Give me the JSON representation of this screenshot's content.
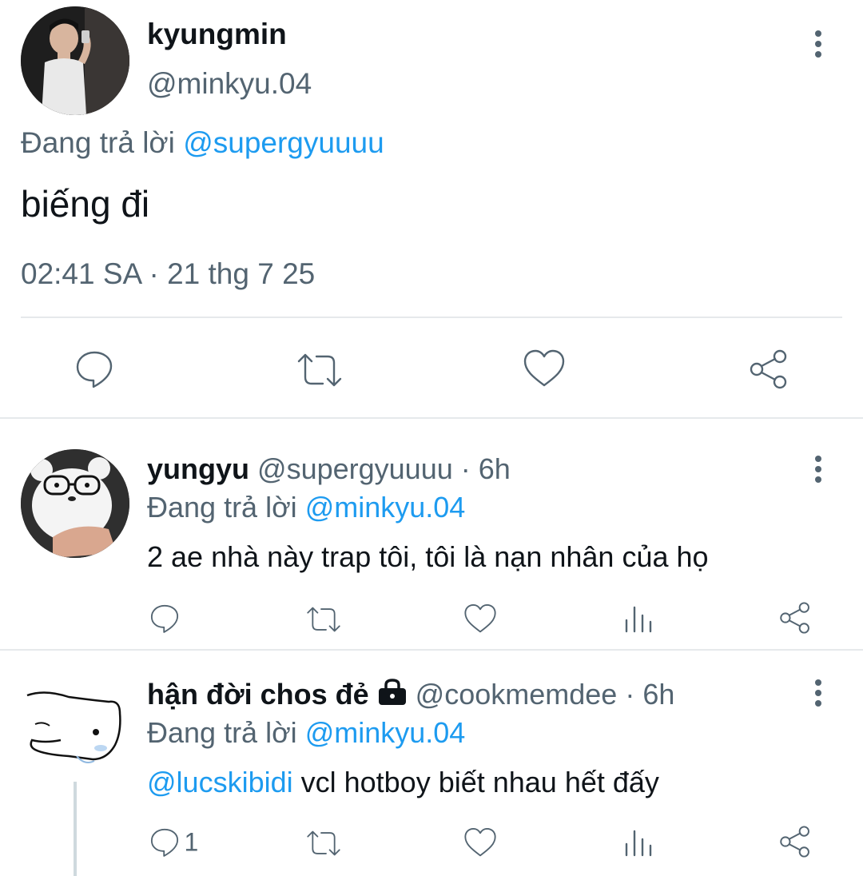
{
  "main_tweet": {
    "display_name": "kyungmin",
    "handle": "@minkyu.04",
    "reply_prefix": "Đang trả lời",
    "reply_to": "@supergyuuuu",
    "text": "biếng đi",
    "timestamp": "02:41 SA · 21 thg 7 25",
    "actions": [
      "reply-icon",
      "retweet-icon",
      "like-icon",
      "share-icon"
    ]
  },
  "replies": [
    {
      "display_name": "yungyu",
      "handle": "@supergyuuuu",
      "time": "· 6h",
      "reply_prefix": "Đang trả lời",
      "reply_to": "@minkyu.04",
      "text": "2 ae nhà này trap tôi, tôi là nạn nhân của họ",
      "reply_count": ""
    },
    {
      "display_name": "hận đời chos đẻ",
      "protected_icon": "lock-icon",
      "handle": "@cookmemdee",
      "time": "· 6h",
      "reply_prefix": "Đang trả lời",
      "reply_to": "@minkyu.04",
      "mention": "@lucskibidi",
      "text": " vcl hotboy biết nhau hết đấy",
      "reply_count": "1"
    }
  ],
  "colors": {
    "accent": "#1d9bf0",
    "secondary_text": "#536471",
    "divider": "#e6e9eb"
  }
}
